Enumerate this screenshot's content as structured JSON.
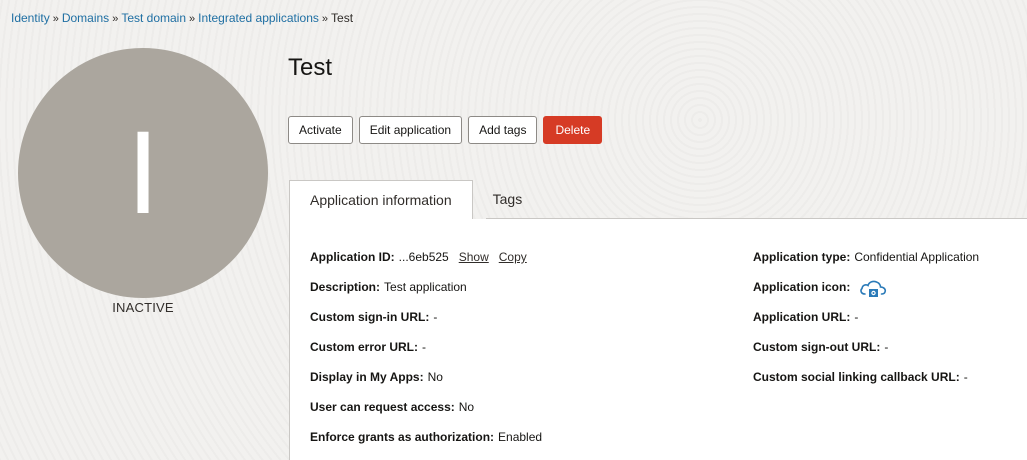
{
  "breadcrumb": [
    {
      "label": "Identity"
    },
    {
      "label": "Domains"
    },
    {
      "label": "Test domain"
    },
    {
      "label": "Integrated applications"
    },
    {
      "label": "Test"
    }
  ],
  "breadcrumb_separator": "»",
  "avatar": {
    "letter": "I",
    "status": "INACTIVE"
  },
  "page": {
    "title": "Test"
  },
  "actions": {
    "activate": "Activate",
    "edit": "Edit application",
    "add_tags": "Add tags",
    "delete": "Delete"
  },
  "tabs": [
    {
      "label": "Application information",
      "active": true
    },
    {
      "label": "Tags",
      "active": false
    }
  ],
  "info": {
    "app_id": {
      "label": "Application ID:",
      "value": "...6eb525",
      "show": "Show",
      "copy": "Copy"
    },
    "description": {
      "label": "Description:",
      "value": "Test application"
    },
    "custom_signin": {
      "label": "Custom sign-in URL:",
      "value": "-"
    },
    "custom_error": {
      "label": "Custom error URL:",
      "value": "-"
    },
    "display_myapps": {
      "label": "Display in My Apps:",
      "value": "No"
    },
    "user_request": {
      "label": "User can request access:",
      "value": "No"
    },
    "enforce_grants": {
      "label": "Enforce grants as authorization:",
      "value": "Enabled"
    },
    "app_type": {
      "label": "Application type:",
      "value": "Confidential Application"
    },
    "app_icon": {
      "label": "Application icon:",
      "icon": "cloud-app-icon"
    },
    "app_url": {
      "label": "Application URL:",
      "value": "-"
    },
    "custom_signout": {
      "label": "Custom sign-out URL:",
      "value": "-"
    },
    "social_callback": {
      "label": "Custom social linking callback URL:",
      "value": "-"
    }
  },
  "colors": {
    "link": "#1f6fa3",
    "danger": "#d63b25",
    "avatar": "#aba69e",
    "icon": "#2a7ab8"
  }
}
